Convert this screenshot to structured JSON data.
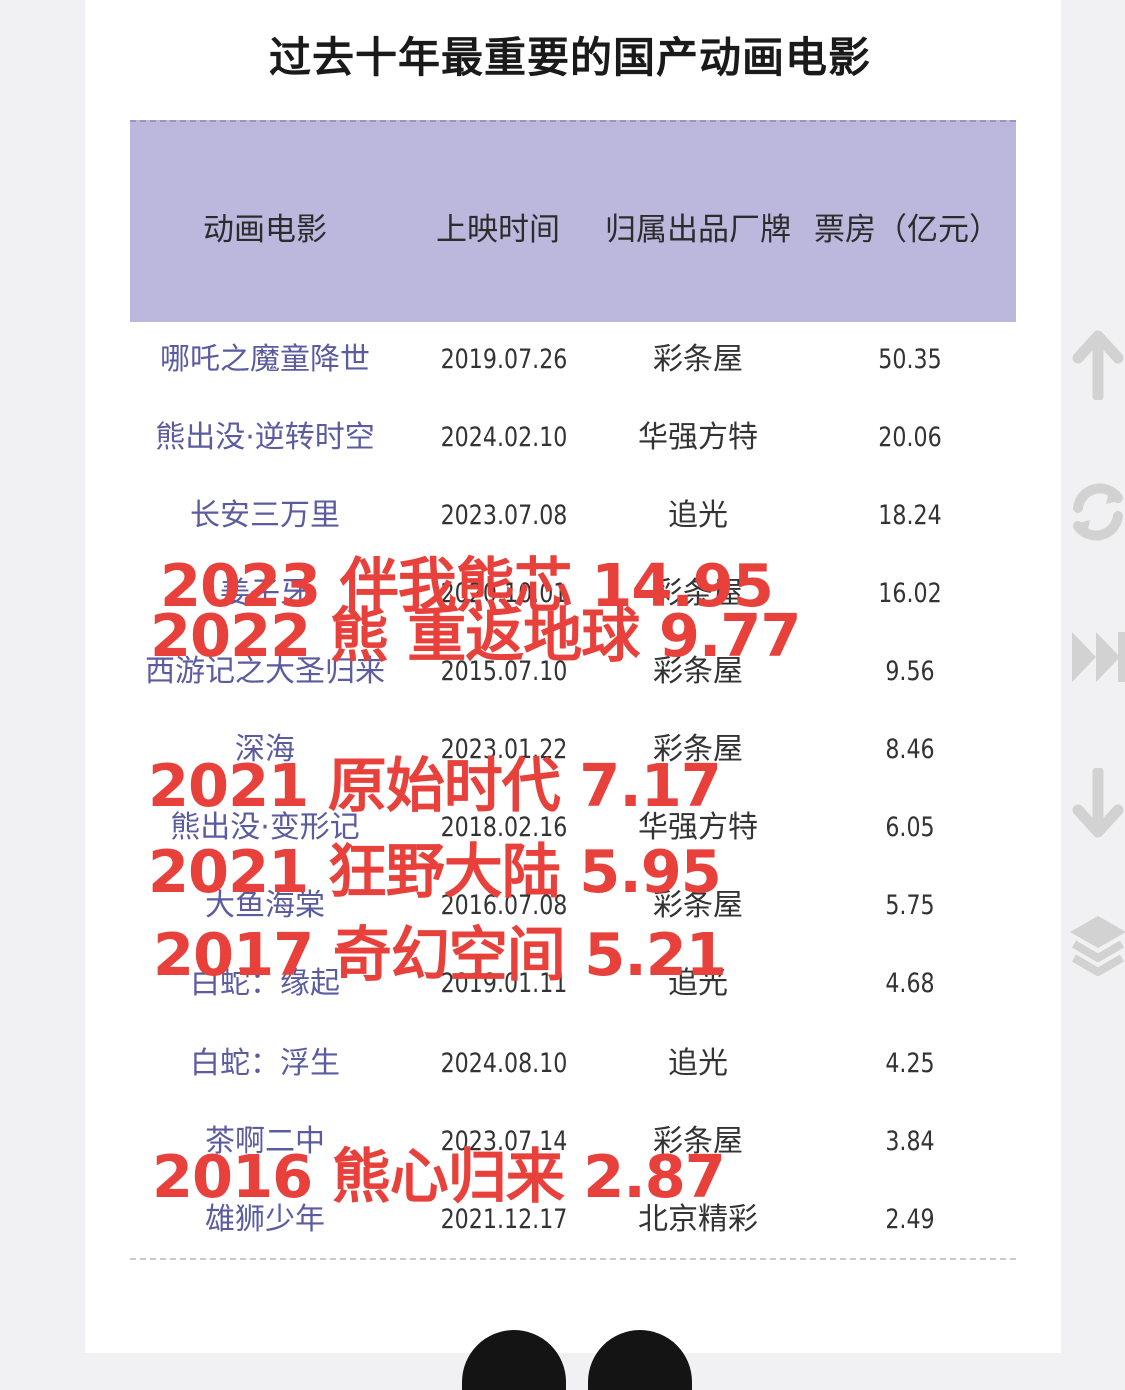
{
  "title": "过去十年最重要的国产动画电影",
  "headers": [
    "动画电影",
    "上映时间",
    "归属出品厂牌",
    "票房（亿元）"
  ],
  "rows": [
    {
      "name": "哪吒之魔童降世",
      "date": "2019.07.26",
      "brand": "彩条屋",
      "box": "50.35"
    },
    {
      "name": "熊出没·逆转时空",
      "date": "2024.02.10",
      "brand": "华强方特",
      "box": "20.06"
    },
    {
      "name": "长安三万里",
      "date": "2023.07.08",
      "brand": "追光",
      "box": "18.24"
    },
    {
      "name": "姜子牙",
      "date": "2020.10.01",
      "brand": "彩条屋",
      "box": "16.02"
    },
    {
      "name": "西游记之大圣归来",
      "date": "2015.07.10",
      "brand": "彩条屋",
      "box": "9.56"
    },
    {
      "name": "深海",
      "date": "2023.01.22",
      "brand": "彩条屋",
      "box": "8.46"
    },
    {
      "name": "熊出没·变形记",
      "date": "2018.02.16",
      "brand": "华强方特",
      "box": "6.05"
    },
    {
      "name": "大鱼海棠",
      "date": "2016.07.08",
      "brand": "彩条屋",
      "box": "5.75"
    },
    {
      "name": "白蛇：缘起",
      "date": "2019.01.11",
      "brand": "追光",
      "box": "4.68"
    },
    {
      "name": "白蛇：浮生",
      "date": "2024.08.10",
      "brand": "追光",
      "box": "4.25"
    },
    {
      "name": "茶啊二中",
      "date": "2023.07.14",
      "brand": "彩条屋",
      "box": "3.84"
    },
    {
      "name": "雄狮少年",
      "date": "2021.12.17",
      "brand": "北京精彩",
      "box": "2.49"
    }
  ],
  "overlays": [
    "2023 伴我熊芯 14.95",
    "2022 熊 重返地球 9.77",
    "2021 原始时代 7.17",
    "2021 狂野大陆 5.95",
    "2017 奇幻空间 5.21",
    "2016 熊心归来 2.87"
  ],
  "side_icons": [
    "arrow-up-icon",
    "refresh-icon",
    "fast-forward-icon",
    "arrow-down-icon",
    "layers-icon"
  ],
  "colors": {
    "header_bg": "#bcb7dc",
    "overlay_text": "#e8413c",
    "name_text": "#5b5ba0",
    "icon": "#d2d2d2"
  }
}
